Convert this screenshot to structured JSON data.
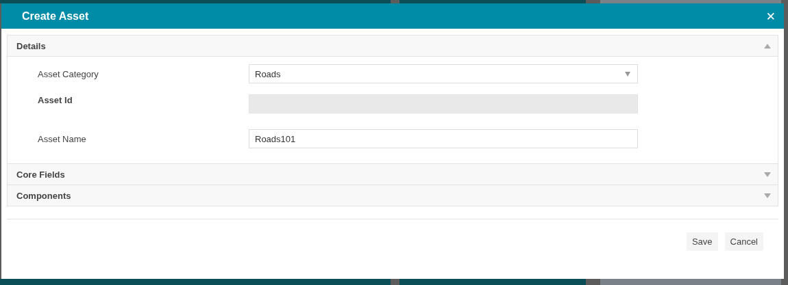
{
  "dialog": {
    "title": "Create Asset",
    "close": "✕"
  },
  "sections": [
    {
      "title": "Details",
      "expanded": true,
      "fields": [
        {
          "label": "Asset Category",
          "kind": "select",
          "value": "Roads",
          "disabled": false
        },
        {
          "label": "Asset Id",
          "kind": "text",
          "disabled": true
        },
        {
          "label": "Asset Name",
          "kind": "text",
          "value": "Roads101",
          "disabled": false
        }
      ]
    },
    {
      "title": "Core Fields",
      "expanded": false
    },
    {
      "title": "Components",
      "expanded": false
    }
  ],
  "buttons": [
    {
      "label": "Save"
    },
    {
      "label": "Cancel"
    }
  ]
}
